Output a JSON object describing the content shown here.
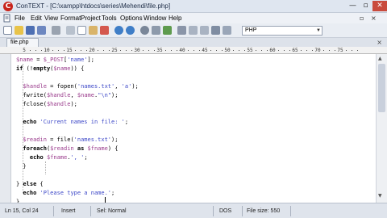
{
  "window": {
    "title": "ConTEXT - [C:\\xampp\\htdocs\\series\\Mehendi\\file.php]",
    "controls": {
      "minimize": "—",
      "maximize": "▫",
      "close": "✕"
    }
  },
  "menu": {
    "items": [
      "File",
      "Edit",
      "View",
      "Format",
      "Project",
      "Tools",
      "Options",
      "Window",
      "Help"
    ],
    "mdi_controls": "▫ ×"
  },
  "toolbar": {
    "highlighter": "PHP",
    "icons": [
      "new-file-icon",
      "open-folder-icon",
      "save-icon",
      "save-all-icon",
      "print-icon",
      "cut-icon",
      "copy-icon",
      "paste-icon",
      "delete-icon",
      "undo-icon",
      "redo-icon",
      "find-icon",
      "find-next-icon",
      "replace-icon",
      "file-compare-icon",
      "indent-icon",
      "outdent-icon",
      "comment-icon",
      "word-wrap-icon",
      "run-icon"
    ]
  },
  "tabs": [
    {
      "label": "file.php",
      "close": "×"
    }
  ],
  "ruler": {
    "labels": [
      "5",
      "10",
      "15",
      "20",
      "25",
      "30",
      "35",
      "40",
      "45",
      "50",
      "55",
      "60",
      "65",
      "70",
      "75"
    ]
  },
  "editor": {
    "lines": [
      [
        {
          "t": "$name",
          "c": "var"
        },
        {
          "t": " = ",
          "c": "op"
        },
        {
          "t": "$_POST",
          "c": "var"
        },
        {
          "t": "[",
          "c": "op"
        },
        {
          "t": "'name'",
          "c": "str"
        },
        {
          "t": "];",
          "c": "op"
        }
      ],
      [
        {
          "t": "if",
          "c": "kw"
        },
        {
          "t": " (",
          "c": "op"
        },
        {
          "t": "!",
          "c": "op"
        },
        {
          "t": "empty",
          "c": "kw"
        },
        {
          "t": "(",
          "c": "op"
        },
        {
          "t": "$name",
          "c": "var"
        },
        {
          "t": ")) {",
          "c": "op"
        }
      ],
      [],
      [
        {
          "t": "  $handle",
          "c": "var"
        },
        {
          "t": " = fopen(",
          "c": "op"
        },
        {
          "t": "'names.txt'",
          "c": "str"
        },
        {
          "t": ", ",
          "c": "op"
        },
        {
          "t": "'a'",
          "c": "str"
        },
        {
          "t": ");",
          "c": "op"
        }
      ],
      [
        {
          "t": "  fwrite(",
          "c": "op"
        },
        {
          "t": "$handle",
          "c": "var"
        },
        {
          "t": ", ",
          "c": "op"
        },
        {
          "t": "$name",
          "c": "var"
        },
        {
          "t": ".",
          "c": "op"
        },
        {
          "t": "\"\\n\"",
          "c": "str"
        },
        {
          "t": ");",
          "c": "op"
        }
      ],
      [
        {
          "t": "  fclose(",
          "c": "op"
        },
        {
          "t": "$handle",
          "c": "var"
        },
        {
          "t": ");",
          "c": "op"
        }
      ],
      [],
      [
        {
          "t": "  echo ",
          "c": "kw"
        },
        {
          "t": "'Current names in file: '",
          "c": "str"
        },
        {
          "t": ";",
          "c": "op"
        }
      ],
      [],
      [
        {
          "t": "  $readin",
          "c": "var"
        },
        {
          "t": " = file(",
          "c": "op"
        },
        {
          "t": "'names.txt'",
          "c": "str"
        },
        {
          "t": ");",
          "c": "op"
        }
      ],
      [
        {
          "t": "  foreach",
          "c": "kw"
        },
        {
          "t": "(",
          "c": "op"
        },
        {
          "t": "$readin",
          "c": "var"
        },
        {
          "t": " as ",
          "c": "kw"
        },
        {
          "t": "$fname",
          "c": "var"
        },
        {
          "t": ") {",
          "c": "op"
        }
      ],
      [
        {
          "t": "    echo ",
          "c": "kw"
        },
        {
          "t": "$fname",
          "c": "var"
        },
        {
          "t": ".",
          "c": "op"
        },
        {
          "t": "', '",
          "c": "str"
        },
        {
          "t": ";",
          "c": "op"
        }
      ],
      [
        {
          "t": "  }",
          "c": "op"
        }
      ],
      [],
      [
        {
          "t": "} ",
          "c": "op"
        },
        {
          "t": "else",
          "c": "kw"
        },
        {
          "t": " {",
          "c": "op"
        }
      ],
      [
        {
          "t": "  echo ",
          "c": "kw"
        },
        {
          "t": "'Please type a name.'",
          "c": "str"
        },
        {
          "t": ";",
          "c": "op"
        }
      ],
      [
        {
          "t": "}",
          "c": "op"
        }
      ]
    ]
  },
  "status": {
    "position": "Ln 15, Col 24",
    "insert_mode": "Insert",
    "selection": "Sel: Normal",
    "line_endings": "DOS",
    "file_size": "File size: 550"
  },
  "colors": {
    "variable": "#9a3b8c",
    "string": "#3e49c8",
    "close_button": "#c94b3d",
    "app_icon": "#c8241c"
  }
}
